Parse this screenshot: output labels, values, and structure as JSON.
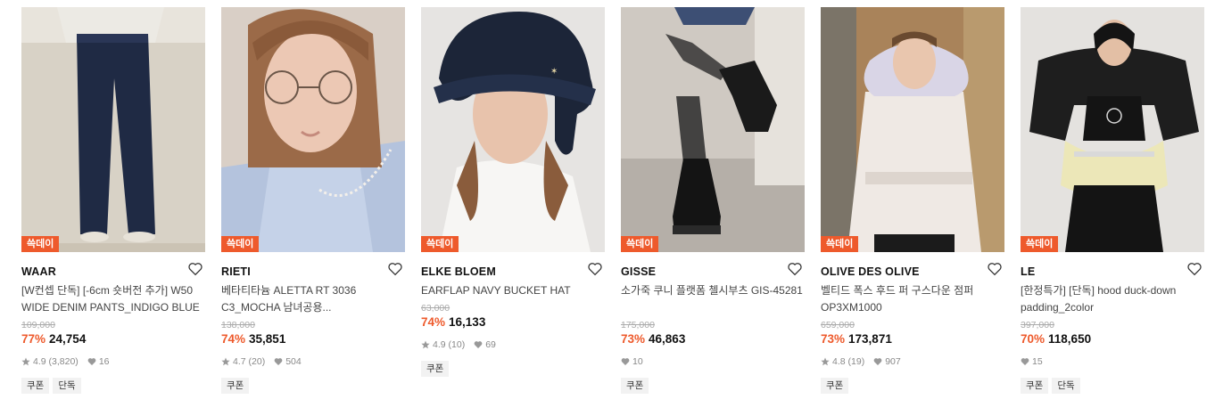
{
  "products": [
    {
      "badge": "쓱데이",
      "brand": "WAAR",
      "name": "[W컨셉 단독] [-6cm 숏버전 추가] W50 WIDE DENIM PANTS_INDIGO BLUE",
      "original_price": "109,000",
      "discount": "77%",
      "price": "24,754",
      "rating": "4.9",
      "reviews": "(3,820)",
      "likes": "16",
      "tags": [
        "쿠폰",
        "단독"
      ]
    },
    {
      "badge": "쓱데이",
      "brand": "RIETI",
      "name": "베타티타늄 ALETTA RT 3036 C3_MOCHA 남녀공용...",
      "original_price": "138,000",
      "discount": "74%",
      "price": "35,851",
      "rating": "4.7",
      "reviews": "(20)",
      "likes": "504",
      "tags": [
        "쿠폰"
      ]
    },
    {
      "badge": "쓱데이",
      "brand": "ELKE BLOEM",
      "name": "EARFLAP NAVY BUCKET HAT",
      "original_price": "63,000",
      "discount": "74%",
      "price": "16,133",
      "rating": "4.9",
      "reviews": "(10)",
      "likes": "69",
      "tags": [
        "쿠폰"
      ]
    },
    {
      "badge": "쓱데이",
      "brand": "GISSE",
      "name": "소가죽 쿠니 플랫폼 첼시부츠 GIS-45281",
      "original_price": "175,000",
      "discount": "73%",
      "price": "46,863",
      "rating": "",
      "reviews": "",
      "likes": "10",
      "tags": [
        "쿠폰"
      ]
    },
    {
      "badge": "쓱데이",
      "brand": "OLIVE DES OLIVE",
      "name": "벨티드 폭스 후드 퍼 구스다운 점퍼 OP3XM1000",
      "original_price": "659,000",
      "discount": "73%",
      "price": "173,871",
      "rating": "4.8",
      "reviews": "(19)",
      "likes": "907",
      "tags": [
        "쿠폰"
      ]
    },
    {
      "badge": "쓱데이",
      "brand": "LE",
      "name": "[한정특가] [단독] hood duck-down padding_2color",
      "original_price": "397,000",
      "discount": "70%",
      "price": "118,650",
      "rating": "",
      "reviews": "",
      "likes": "15",
      "tags": [
        "쿠폰",
        "단독"
      ]
    }
  ],
  "colors": {
    "accent": "#ee5a2c",
    "muted": "#aaaaaa",
    "tag_bg": "#f2f2f2"
  },
  "icons": {
    "like": "heart-outline-icon",
    "rating": "star-icon",
    "likes_count": "heart-filled-icon"
  }
}
